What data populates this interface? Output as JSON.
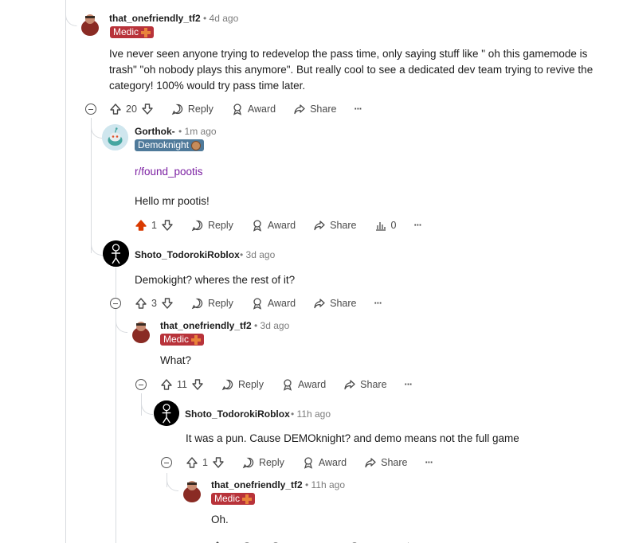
{
  "comments": [
    {
      "author": "that_onefriendly_tf2",
      "time": "4d ago",
      "flair": "Medic",
      "body": [
        "Ive never seen anyone trying to redevelop the pass time, only saying stuff like \" oh this gamemode is",
        "trash\" \"oh nobody plays this anymore\". But really cool to see a dedicated dev team trying to revive the",
        "category! 100% would try pass time later."
      ],
      "votes": "20"
    },
    {
      "author": "Gorthok-",
      "time": "1m ago",
      "flair": "Demoknight",
      "link": "r/found_pootis",
      "body": [
        "Hello mr pootis!"
      ],
      "votes": "1",
      "stats": "0"
    },
    {
      "author": "Shoto_TodorokiRoblox",
      "time": "3d ago",
      "body": [
        "Demokight? wheres the rest of it?"
      ],
      "votes": "3"
    },
    {
      "author": "that_onefriendly_tf2",
      "time": "3d ago",
      "flair": "Medic",
      "body": [
        "What?"
      ],
      "votes": "11"
    },
    {
      "author": "Shoto_TodorokiRoblox",
      "time": "11h ago",
      "body": [
        "It was a pun. Cause DEMOknight? and demo means not the full game"
      ],
      "votes": "1"
    },
    {
      "author": "that_onefriendly_tf2",
      "time": "11h ago",
      "flair": "Medic",
      "body": [
        "Oh."
      ]
    }
  ],
  "actions": {
    "reply": "Reply",
    "award": "Award",
    "share": "Share",
    "more": "···"
  },
  "colors": {
    "medic": "#b8333a",
    "demo": "#4f7a9a",
    "upvoted": "#d93a00",
    "link": "#7b1fa2"
  }
}
